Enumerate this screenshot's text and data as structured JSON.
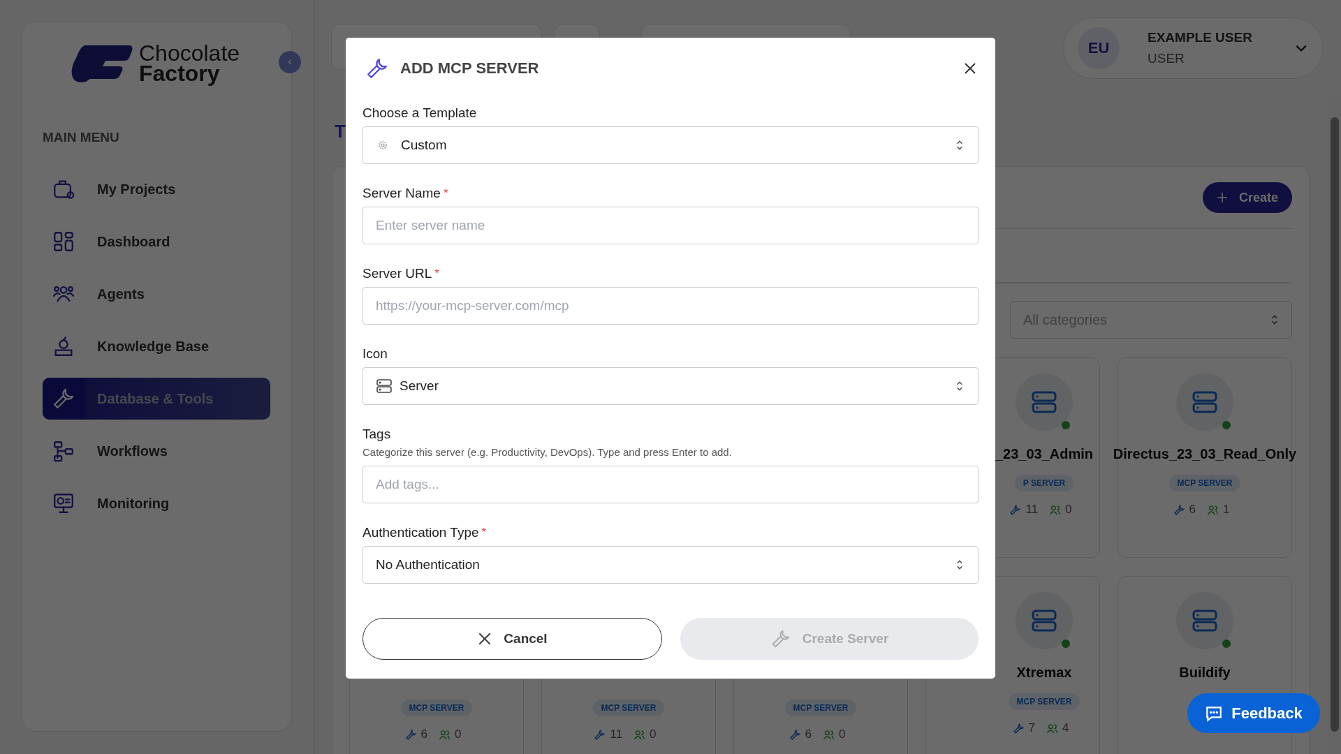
{
  "sidebar": {
    "logo": {
      "line1": "Chocolate",
      "line2": "Factory"
    },
    "section_title": "MAIN MENU",
    "items": [
      {
        "label": "My Projects",
        "kind": "projects",
        "selected": false
      },
      {
        "label": "Dashboard",
        "kind": "dashboard",
        "selected": false
      },
      {
        "label": "Agents",
        "kind": "agents",
        "selected": false
      },
      {
        "label": "Knowledge Base",
        "kind": "knowledge",
        "selected": false
      },
      {
        "label": "Database & Tools",
        "kind": "tools",
        "selected": true
      },
      {
        "label": "Workflows",
        "kind": "workflows",
        "selected": false
      },
      {
        "label": "Monitoring",
        "kind": "monitoring",
        "selected": false
      }
    ]
  },
  "header": {
    "user": {
      "initials": "EU",
      "name": "EXAMPLE USER",
      "role": "USER"
    }
  },
  "page": {
    "title": "T",
    "create_button": "Create",
    "category_filter": {
      "placeholder": "All categories"
    },
    "cards": [
      {
        "kind": "clipped",
        "name": "_23_03_Admin",
        "badge": "P SERVER",
        "tools": "11",
        "users": "0"
      },
      {
        "kind": "full",
        "name": "Directus_23_03_Read_Only",
        "badge": "MCP SERVER",
        "tools": "6",
        "users": "1"
      },
      {
        "kind": "bottom",
        "badge": "MCP SERVER",
        "tools": "6",
        "users": "0"
      },
      {
        "kind": "bottom",
        "badge": "MCP SERVER",
        "tools": "11",
        "users": "0"
      },
      {
        "kind": "bottom",
        "badge": "MCP SERVER",
        "tools": "6",
        "users": "0"
      },
      {
        "kind": "clipped",
        "name": "Xtremax",
        "badge": "MCP SERVER",
        "tools": "7",
        "users": "4"
      },
      {
        "kind": "full",
        "name": "Buildify"
      }
    ]
  },
  "dialog": {
    "title": "ADD MCP SERVER",
    "fields": [
      {
        "kind": "template",
        "label": "Choose a Template",
        "value": "Custom"
      },
      {
        "kind": "input",
        "label": "Server Name",
        "required_mark": "*",
        "placeholder": "Enter server name"
      },
      {
        "kind": "input",
        "label": "Server URL",
        "required_mark": "*",
        "placeholder": "https://your-mcp-server.com/mcp"
      },
      {
        "kind": "icon",
        "label": "Icon",
        "value": "Server"
      },
      {
        "kind": "input",
        "label": "Tags",
        "hint": "Categorize this server (e.g. Productivity, DevOps). Type and press Enter to add.",
        "placeholder": "Add tags..."
      },
      {
        "kind": "select",
        "label": "Authentication Type",
        "required_mark": "*",
        "value": "No Authentication"
      }
    ],
    "cancel_button": {
      "label": "Cancel",
      "disabled": false
    },
    "submit_button": {
      "label": "Create Server",
      "disabled": true
    }
  },
  "feedback_button": "Feedback"
}
